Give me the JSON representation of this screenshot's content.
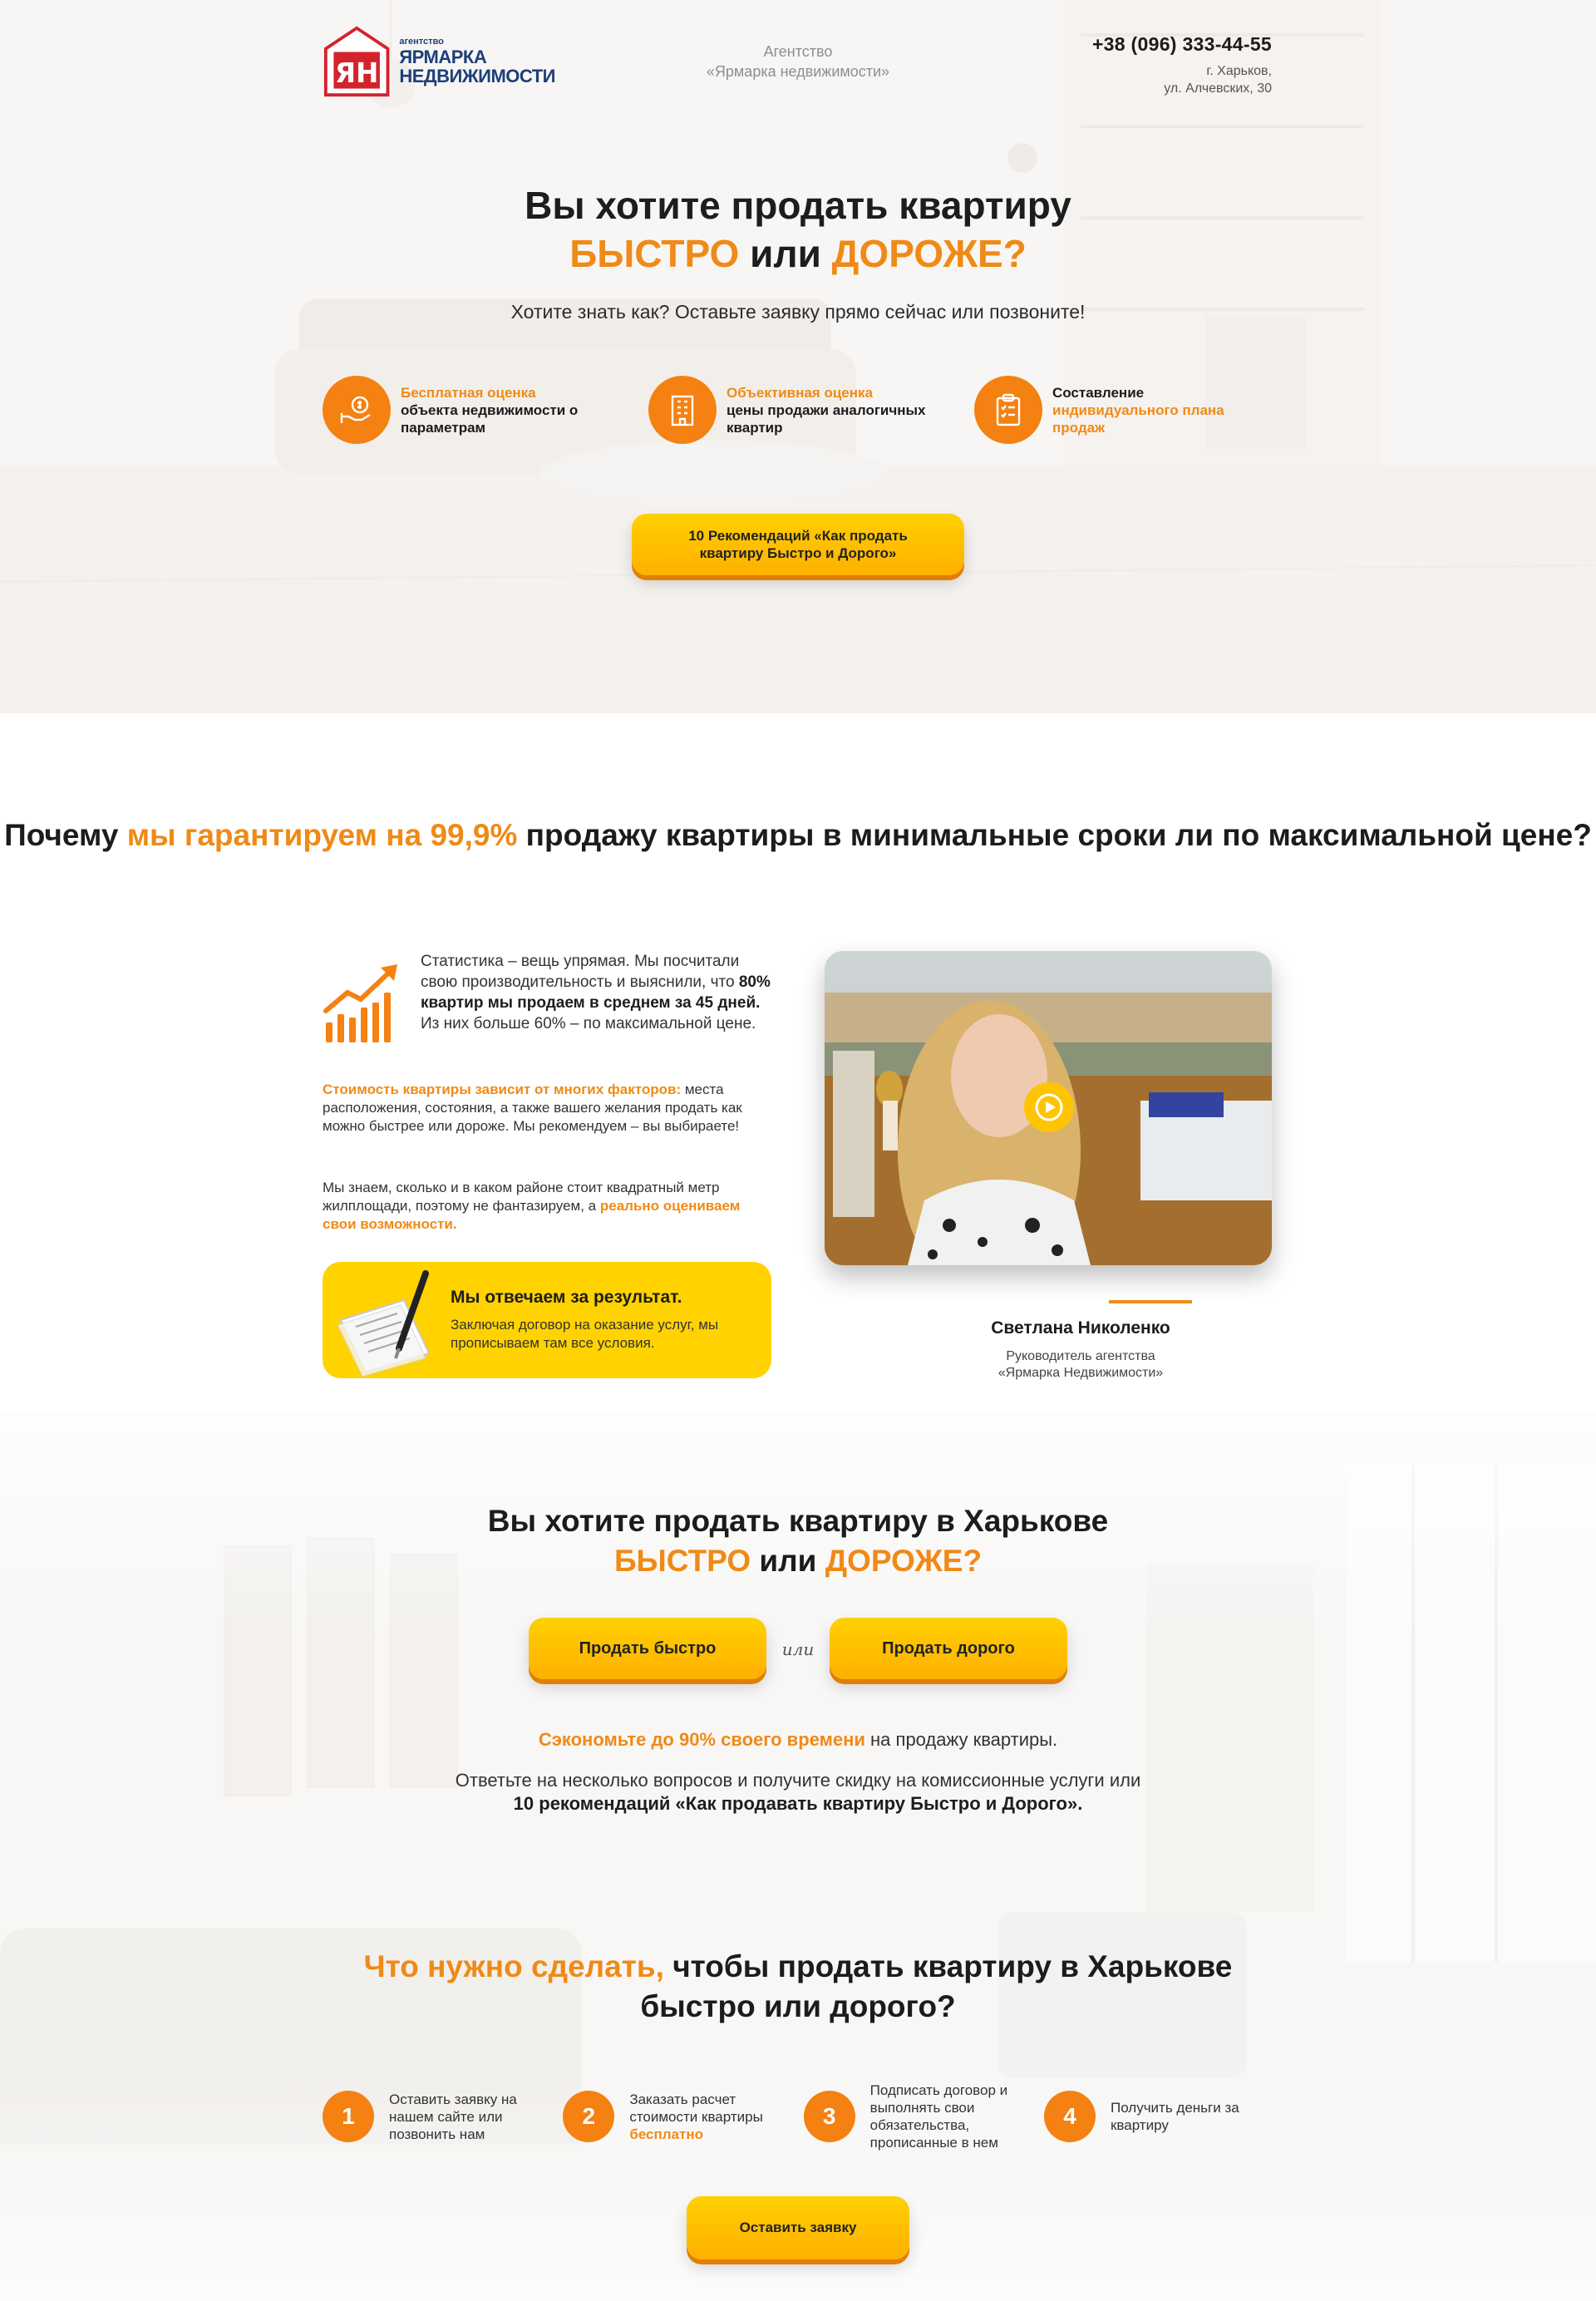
{
  "header": {
    "logo_small": "агентство",
    "logo_line1": "ЯРМАРКА",
    "logo_line2": "НЕДВИЖИМОСТИ",
    "logo_mark": "ЯН",
    "agency_line1": "Агентство",
    "agency_line2": "«Ярмарка недвижимости»",
    "phone": "+38 (096) 333-44-55",
    "address_line1": "г. Харьков,",
    "address_line2": "ул. Алчевских, 30"
  },
  "hero": {
    "title_line1": "Вы хотите продать квартиру",
    "title_fast": "БЫСТРО",
    "title_or": "или",
    "title_expensive": "ДОРОЖЕ?",
    "subtitle": "Хотите знать как? Оставьте заявку прямо сейчас или позвоните!",
    "features": [
      {
        "icon": "money-hand-icon",
        "highlight": "Бесплатная оценка",
        "text": "объекта недвижимости о параметрам"
      },
      {
        "icon": "building-icon",
        "highlight": "Объективная оценка",
        "text": "цены продажи аналогичных квартир"
      },
      {
        "icon": "clipboard-list-icon",
        "prefix": "Составление",
        "highlight": "индивидуального плана продаж"
      }
    ],
    "cta": "10 Рекомендаций «Как продать квартиру Быстро и Дорого»"
  },
  "why": {
    "title_pre": "Почему",
    "title_highlight": "мы гарантируем на 99,9%",
    "title_post": "продажу квартиры в минимальные сроки ли по максимальной цене?",
    "stat_pre": "Статистика – вещь упрямая. Мы посчитали свою производительность и выяснили, что",
    "stat_bold": "80% квартир мы продаем в среднем за 45 дней.",
    "stat_post": "Из них больше 60% – по максимальной цене.",
    "p2_highlight": "Стоимость квартиры зависит от многих факторов:",
    "p2_text": "места расположения, состояния, а также вашего желания продать как можно быстрее или дороже. Мы рекомендуем – вы выбираете!",
    "p3_text": "Мы знаем, сколько и в каком районе стоит квадратный метр жилплощади, поэтому не фантазируем, а",
    "p3_highlight": "реально оцениваем свои возможности.",
    "result_title": "Мы отвечаем за результат.",
    "result_text": "Заключая договор на оказание услуг, мы прописываем там все условия.",
    "person_name": "Светлана Николенко",
    "person_role_line1": "Руководитель агентства",
    "person_role_line2": "«Ярмарка Недвижимости»"
  },
  "choose": {
    "title_line1": "Вы хотите продать квартиру в Харькове",
    "title_fast": "БЫСТРО",
    "title_or": "или",
    "title_expensive": "ДОРОЖЕ?",
    "btn_fast": "Продать быстро",
    "or_label": "или",
    "btn_expensive": "Продать дорого",
    "save_highlight": "Сэкономьте до 90% своего времени",
    "save_text": "на продажу квартиры.",
    "answer_line1": "Ответьте на несколько вопросов и получите скидку на комиссионные услуги или",
    "answer_line2": "10 рекомендаций «Как продавать квартиру Быстро и Дорого»."
  },
  "steps_section": {
    "title_highlight": "Что нужно сделать,",
    "title_line1": "чтобы продать квартиру в Харькове",
    "title_line2": "быстро или дорого?",
    "steps": [
      {
        "num": "1",
        "text": "Оставить заявку на нашем сайте или позвонить нам"
      },
      {
        "num": "2",
        "text": "Заказать расчет стоимости квартиры",
        "highlight": "бесплатно"
      },
      {
        "num": "3",
        "text": "Подписать договор и выполнять свои обязательства, прописанные в нем"
      },
      {
        "num": "4",
        "text": "Получить деньги за квартиру"
      }
    ],
    "cta": "Оставить заявку"
  },
  "colors": {
    "accent": "#f08a16",
    "button": "#ffc400",
    "brand_red": "#d4222b",
    "brand_blue": "#1d3f7a"
  }
}
